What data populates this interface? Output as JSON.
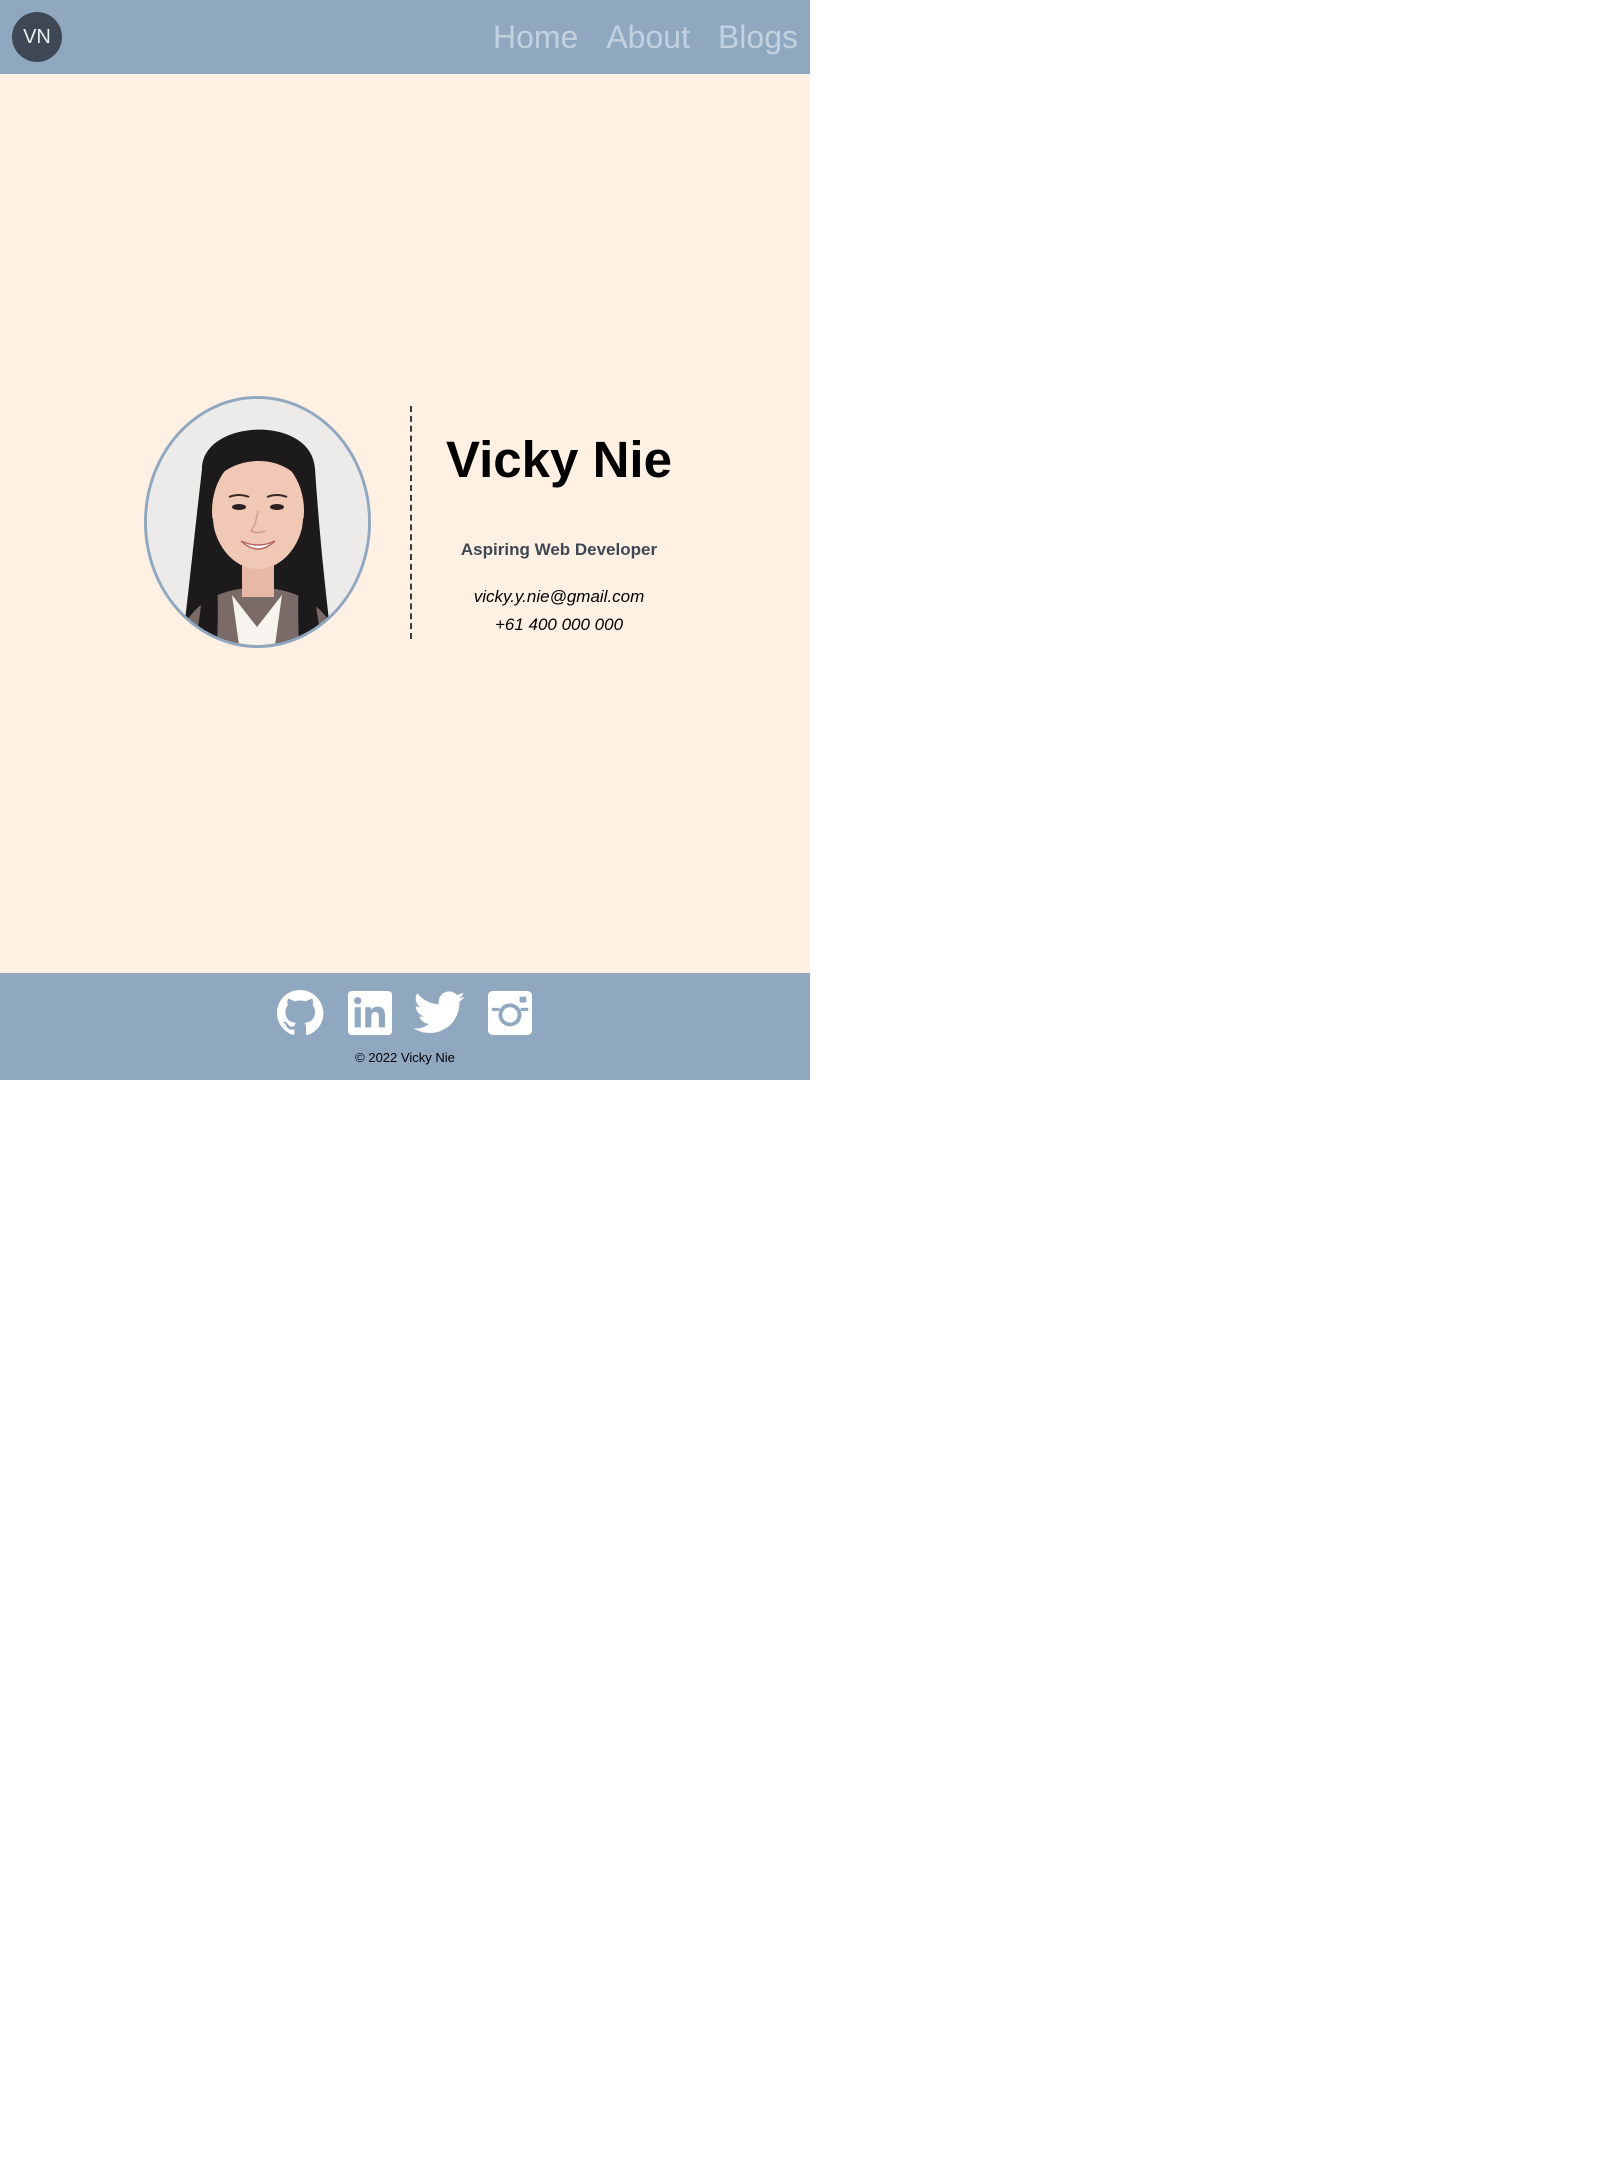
{
  "header": {
    "logo_text": "VN",
    "nav": {
      "home": "Home",
      "about": "About",
      "blogs": "Blogs"
    }
  },
  "profile": {
    "name": "Vicky Nie",
    "role": "Aspiring Web Developer",
    "email": "vicky.y.nie@gmail.com",
    "phone": "+61 400 000 000"
  },
  "footer": {
    "social": [
      "github-icon",
      "linkedin-icon",
      "twitter-icon",
      "instagram-icon"
    ],
    "copyright": "© 2022 Vicky Nie"
  },
  "colors": {
    "header_bg": "#8fa8c0",
    "main_bg": "#fef0e3",
    "logo_bg": "#3d4854",
    "nav_text": "#c3d1df"
  }
}
